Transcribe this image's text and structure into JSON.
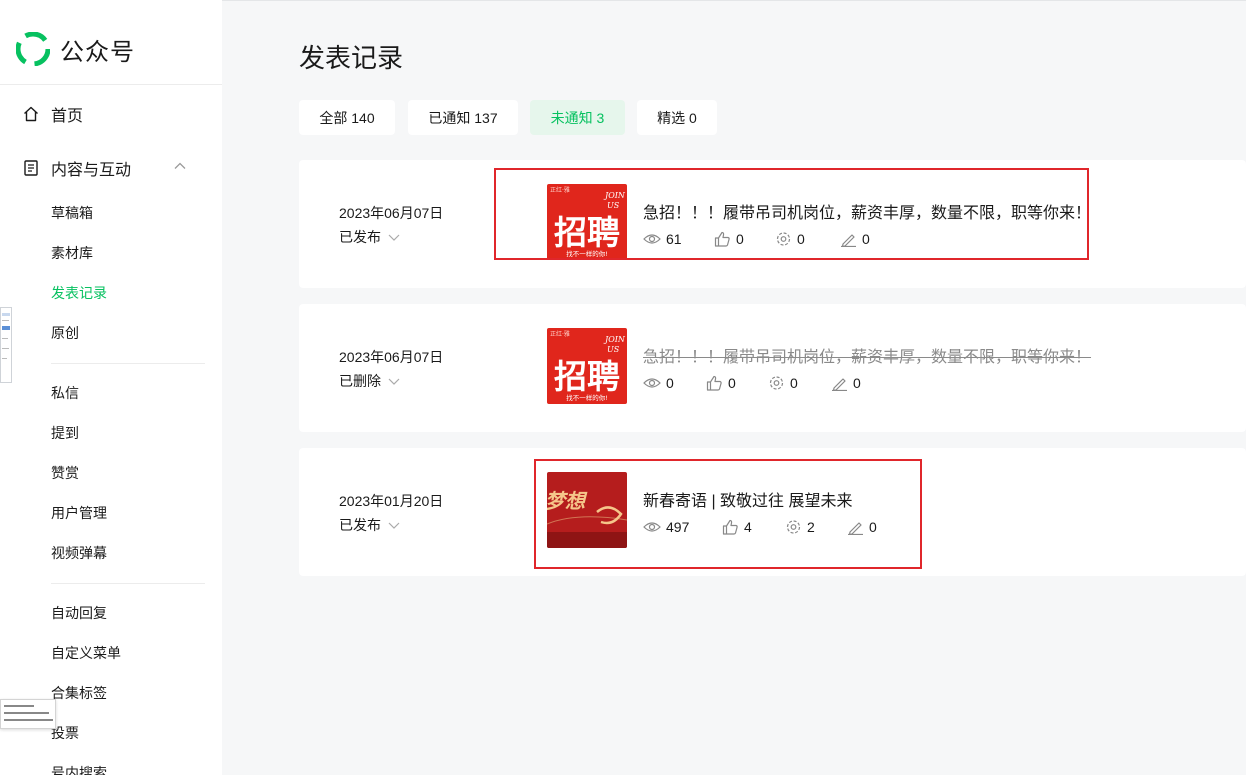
{
  "brand": {
    "name": "公众号"
  },
  "sidebar": {
    "home": "首页",
    "content": "内容与互动",
    "content_items": [
      "草稿箱",
      "素材库",
      "发表记录",
      "原创"
    ],
    "group2": [
      "私信",
      "提到",
      "赞赏",
      "用户管理",
      "视频弹幕"
    ],
    "group3": [
      "自动回复",
      "自定义菜单",
      "合集标签",
      "投票",
      "号内搜索"
    ]
  },
  "page": {
    "title": "发表记录"
  },
  "tabs": [
    "全部 140",
    "已通知 137",
    "未通知 3",
    "精选 0"
  ],
  "articles": [
    {
      "date": "2023年06月07日",
      "status": "已发布",
      "title": "急招！！！履带吊司机岗位，薪资丰厚，数量不限，职等你来！",
      "views": "61",
      "likes": "0",
      "shares": "0",
      "comments": "0",
      "thumb": {
        "big": "招聘",
        "tag1": "JOIN",
        "tag2": "US",
        "sub": "找不一样的你!",
        "corner": "正红·雅"
      }
    },
    {
      "date": "2023年06月07日",
      "status": "已删除",
      "title": "急招！！！履带吊司机岗位，薪资丰厚，数量不限，职等你来！",
      "views": "0",
      "likes": "0",
      "shares": "0",
      "comments": "0",
      "thumb": {
        "big": "招聘",
        "tag1": "JOIN",
        "tag2": "US",
        "sub": "找不一样的你!",
        "corner": "正红·雅"
      }
    },
    {
      "date": "2023年01月20日",
      "status": "已发布",
      "title": "新春寄语 | 致敬过往 展望未来",
      "views": "497",
      "likes": "4",
      "shares": "2",
      "comments": "0",
      "thumb": {
        "big": "梦想",
        "tag1": "",
        "tag2": "",
        "sub": "",
        "corner": ""
      }
    }
  ],
  "colors": {
    "accent": "#07c160",
    "highlight": "#e0262b",
    "thumb_red": "#e0261c",
    "thumb_dark_red": "#b51d1d"
  }
}
